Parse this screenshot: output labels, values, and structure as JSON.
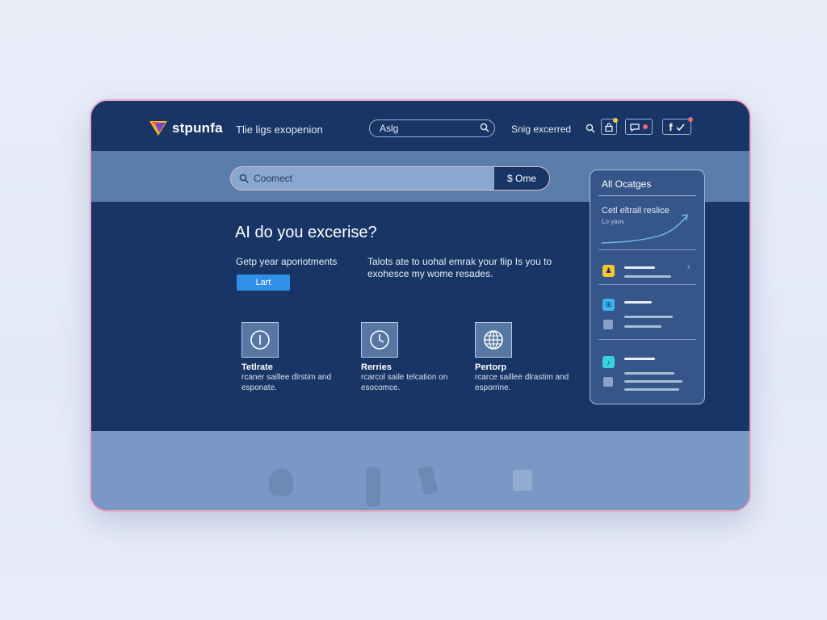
{
  "brand": {
    "name": "stpunfa",
    "tagline": "Tlie ligs exopenion"
  },
  "nav": {
    "search_value": "Aslg",
    "link": "Snig excerred",
    "icons": [
      "search-icon",
      "lock-icon",
      "chat-icon",
      "share-icon"
    ],
    "badge_color": "#f2667d"
  },
  "main_search": {
    "value": "Coomect",
    "button": "$ Ome"
  },
  "hero": {
    "headline": "AI do you excerise?",
    "sub_left": "Getp year aporiotments",
    "sub_right": "Talots ate to uohal emrak your fiip Is you to exohesce my wome resades.",
    "cta": "Lart"
  },
  "features": [
    {
      "icon": "info-icon",
      "title": "Tetlrate",
      "desc": "rcaner saillee dlrstim and esponate."
    },
    {
      "icon": "clock-icon",
      "title": "Rerries",
      "desc": "rcarcol saile telcation on esocomce."
    },
    {
      "icon": "globe-icon",
      "title": "Pertorp",
      "desc": "rcarce saillee dlrastim and esporrine."
    }
  ],
  "panel": {
    "title": "All Ocatges",
    "trend_label": "Cetl eltrail reslice",
    "trend_sub": "Lo yaov",
    "items": [
      {
        "chip_color": "#f3c632",
        "chip_glyph": "♟"
      },
      {
        "chip_color": "#3fb3f0",
        "chip_glyph": "⊞"
      },
      {
        "chip_color": "#37d3d9",
        "chip_glyph": "♪"
      }
    ]
  },
  "colors": {
    "accent": "#2f8fe9",
    "nav_bg": "#183566",
    "band": "#5a7eac"
  }
}
